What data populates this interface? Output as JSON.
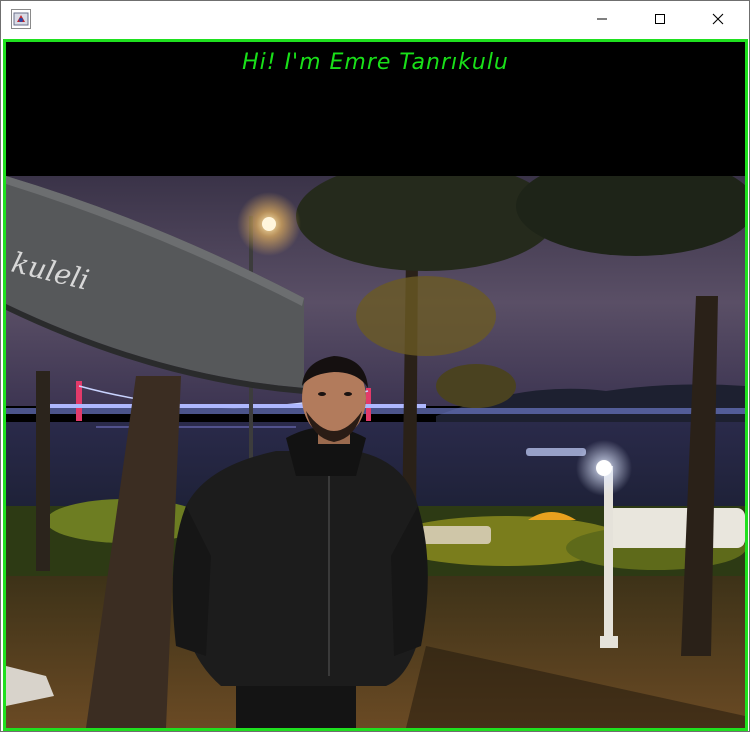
{
  "window": {
    "icon": "java-app-icon",
    "controls": {
      "minimize": "minimize-icon",
      "maximize": "maximize-icon",
      "close": "close-icon"
    }
  },
  "header": {
    "greeting": "Hi! I'm Emre Tanrıkulu"
  },
  "photo": {
    "awning_text": "kuleli",
    "subject": "man in black jacket at night by the Bosphorus with lit bridge in background"
  },
  "colors": {
    "accent": "#1fe01f",
    "greeting_text": "#19e019",
    "panel_background": "#000000"
  }
}
